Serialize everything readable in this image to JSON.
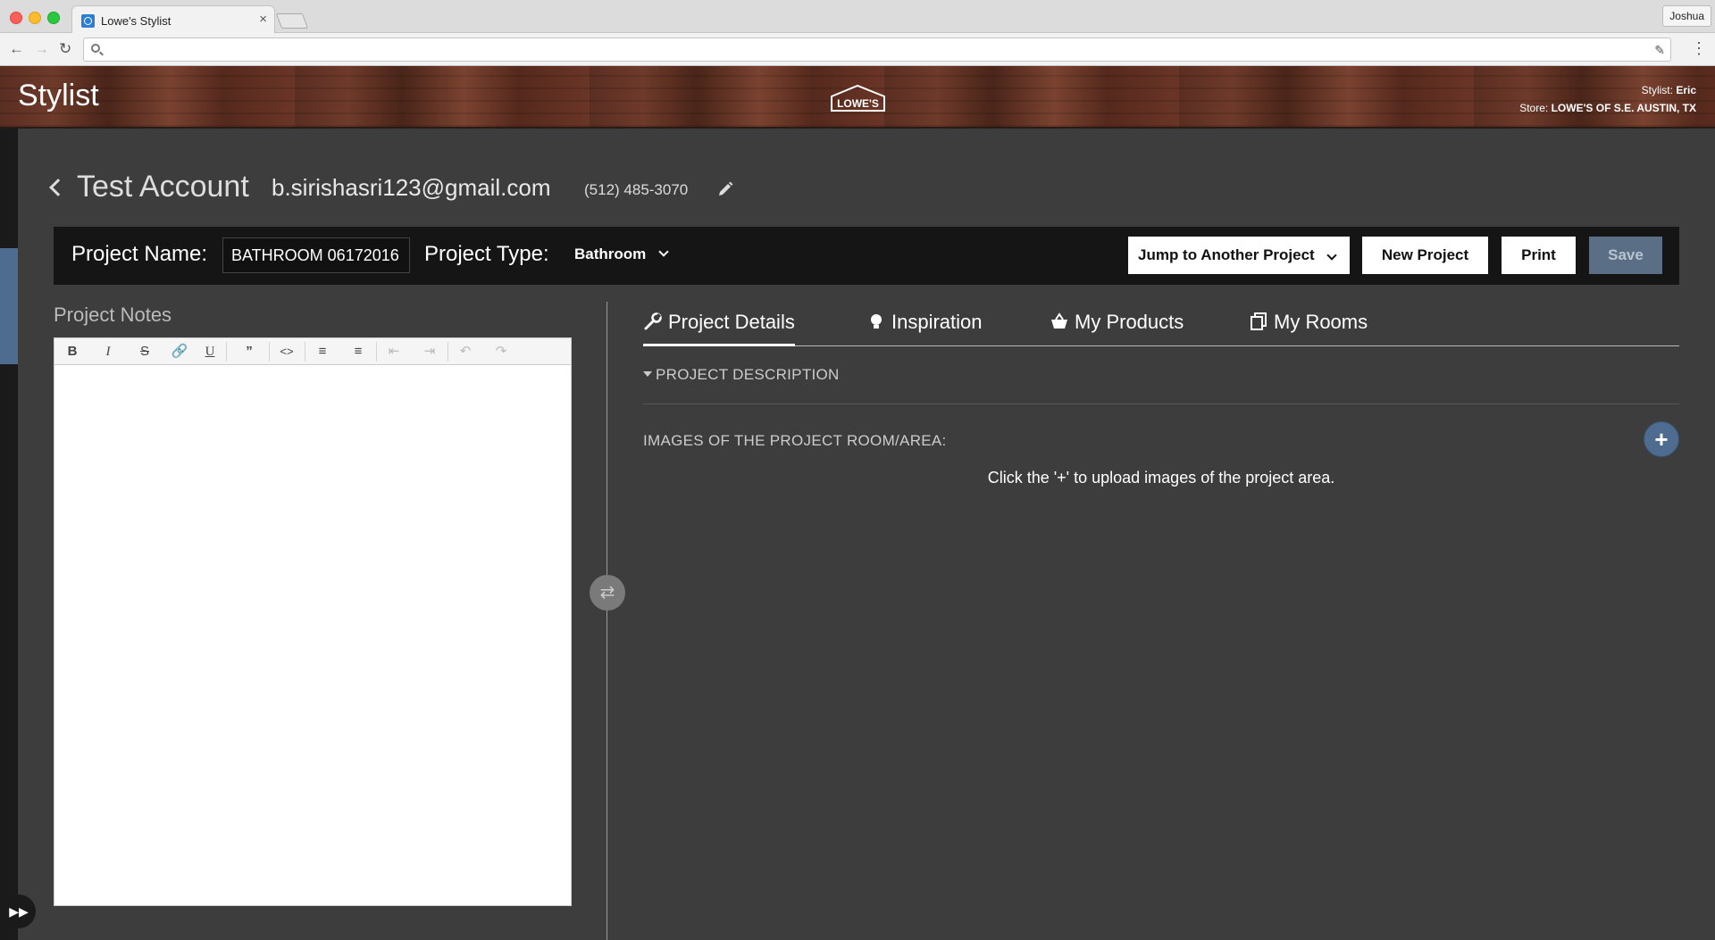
{
  "browser": {
    "tab_title": "Lowe's Stylist",
    "tab_close": "×",
    "profile": "Joshua",
    "address": ""
  },
  "header": {
    "app_title": "Stylist",
    "logo_text": "LOWE'S",
    "stylist_label": "Stylist:",
    "stylist_name": "Eric",
    "store_label": "Store:",
    "store_name": "LOWE'S OF S.E. AUSTIN, TX"
  },
  "customer": {
    "name": "Test Account",
    "email": "b.sirishasri123@gmail.com",
    "phone": "(512) 485-3070"
  },
  "project": {
    "name_label": "Project Name:",
    "name_value": "BATHROOM 06172016",
    "type_label": "Project Type:",
    "type_value": "Bathroom",
    "jump_label": "Jump to Another Project",
    "new_label": "New Project",
    "print_label": "Print",
    "save_label": "Save"
  },
  "notes": {
    "label": "Project Notes",
    "content": ""
  },
  "tabs": [
    {
      "label": "Project Details",
      "icon": "wrench-icon",
      "active": true
    },
    {
      "label": "Inspiration",
      "icon": "lightbulb-icon",
      "active": false
    },
    {
      "label": "My Products",
      "icon": "basket-icon",
      "active": false
    },
    {
      "label": "My Rooms",
      "icon": "rooms-icon",
      "active": false
    }
  ],
  "details": {
    "section_title": "PROJECT DESCRIPTION",
    "images_label": "IMAGES OF THE PROJECT ROOM/AREA:",
    "upload_hint": "Click the '+' to upload images of the project area."
  },
  "colors": {
    "accent": "#4e6c8f",
    "background": "#3d3d3d",
    "bar": "#151515"
  }
}
